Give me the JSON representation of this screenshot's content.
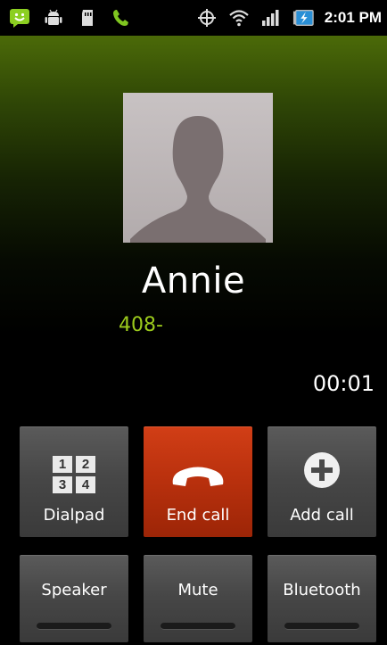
{
  "status_bar": {
    "time": "2:01 PM",
    "icons": [
      "chat-smiley-icon",
      "android-debug-icon",
      "sd-card-icon",
      "phone-call-icon",
      "gps-icon",
      "wifi-icon",
      "signal-icon",
      "battery-charging-icon"
    ]
  },
  "caller": {
    "name": "Annie",
    "number": "408-",
    "timer": "00:01"
  },
  "buttons": {
    "dialpad": {
      "label": "Dialpad",
      "keys": [
        "1",
        "2",
        "3",
        "4"
      ]
    },
    "end_call": {
      "label": "End call"
    },
    "add_call": {
      "label": "Add call"
    },
    "speaker": {
      "label": "Speaker"
    },
    "mute": {
      "label": "Mute"
    },
    "bluetooth": {
      "label": "Bluetooth"
    }
  },
  "colors": {
    "number_green": "#9ccb1c",
    "end_call_red": "#c0330f",
    "header_green": "#4b6a08"
  }
}
